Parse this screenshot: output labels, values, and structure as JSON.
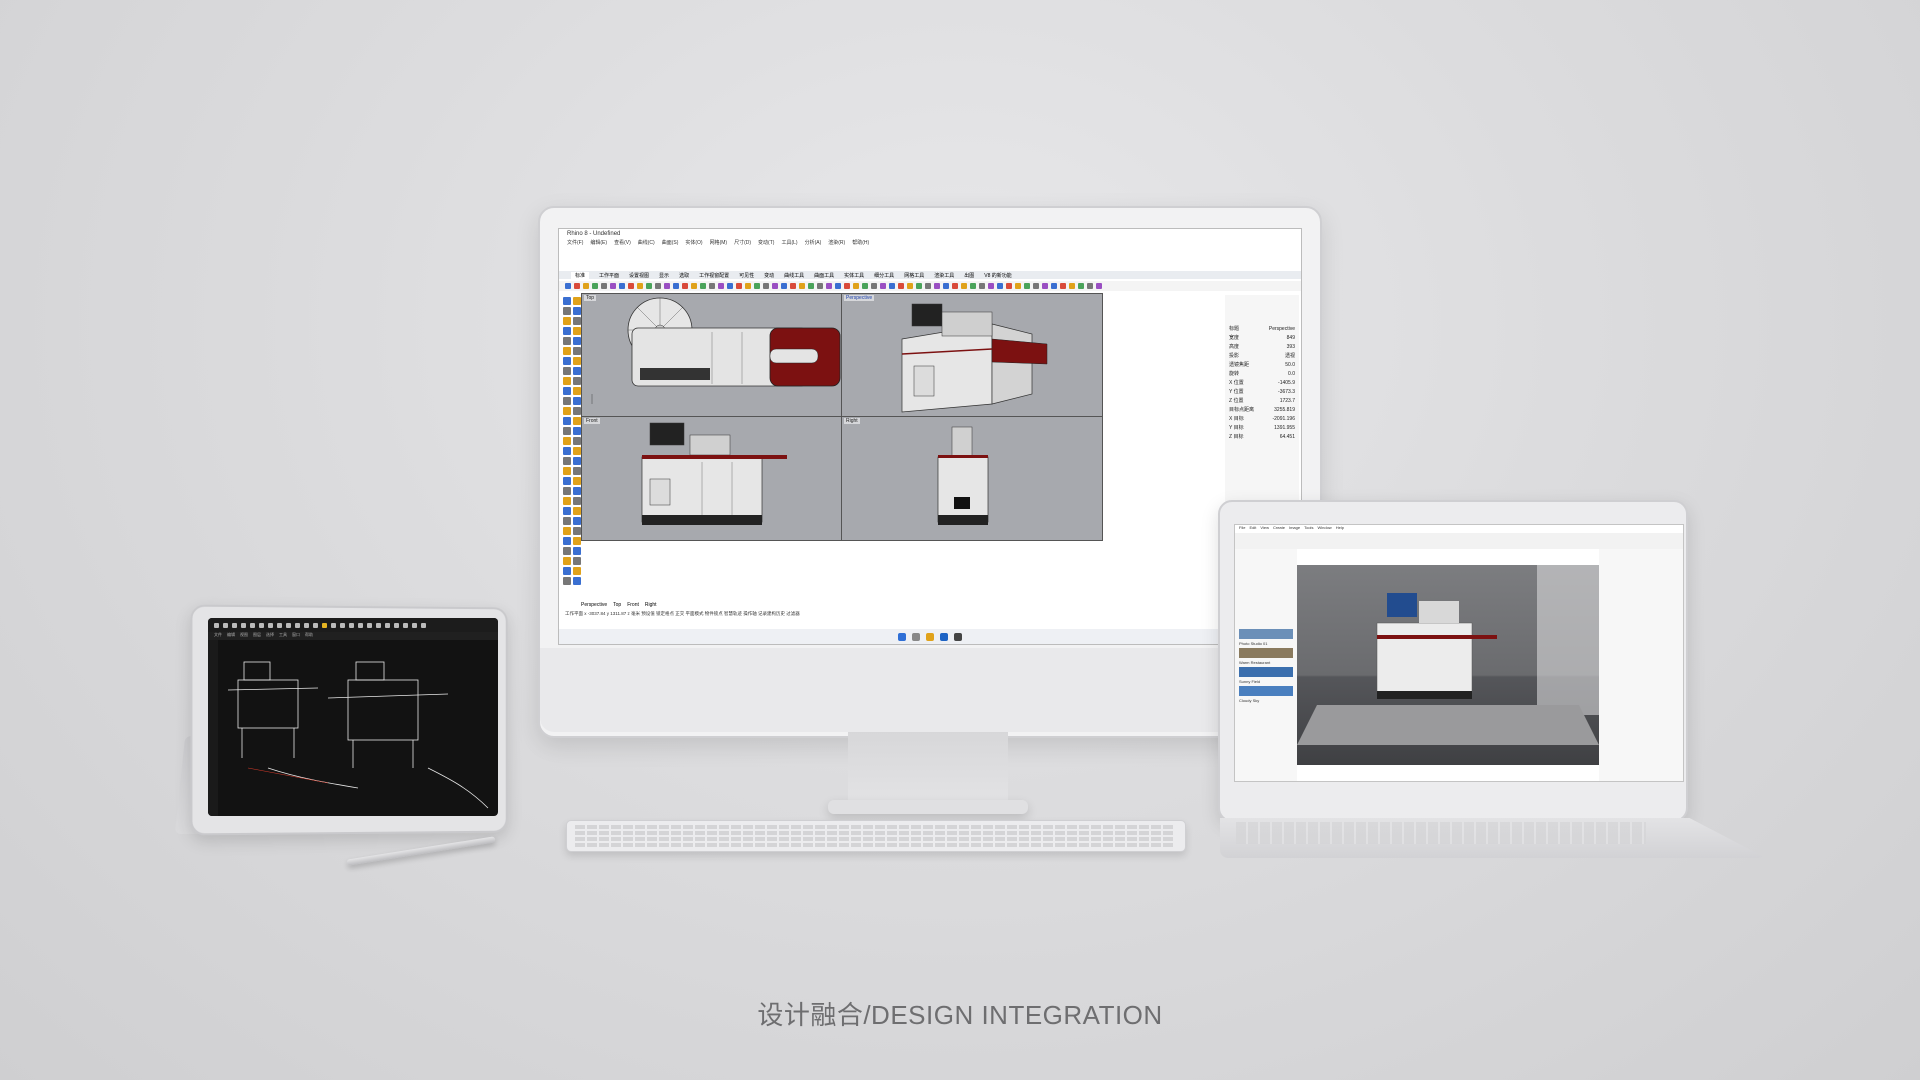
{
  "caption": "设计融合/DESIGN INTEGRATION",
  "monitor": {
    "window_title": "Rhino 8 - Undefined",
    "menus": [
      "文件(F)",
      "编辑(E)",
      "查看(V)",
      "曲线(C)",
      "曲面(S)",
      "实体(O)",
      "网格(M)",
      "尺寸(D)",
      "变动(T)",
      "工具(L)",
      "分析(A)",
      "渲染(R)",
      "帮助(H)"
    ],
    "tabs": [
      "标准",
      "工作平面",
      "设置视图",
      "显示",
      "选取",
      "工作视窗配置",
      "可见性",
      "变动",
      "曲线工具",
      "曲面工具",
      "实体工具",
      "细分工具",
      "网格工具",
      "渲染工具",
      "出图",
      "V8 的新功能"
    ],
    "viewports": [
      "Top",
      "Perspective",
      "Front",
      "Right"
    ],
    "viewport_tabs": [
      "Perspective",
      "Top",
      "Front",
      "Right"
    ],
    "properties": [
      {
        "k": "标题",
        "v": "Perspective"
      },
      {
        "k": "宽度",
        "v": "849"
      },
      {
        "k": "高度",
        "v": "393"
      },
      {
        "k": "投影",
        "v": "透视"
      },
      {
        "k": "透镜焦距",
        "v": "50.0"
      },
      {
        "k": "旋转",
        "v": "0.0"
      },
      {
        "k": "X 位置",
        "v": "-1405.9"
      },
      {
        "k": "Y 位置",
        "v": "-3673.3"
      },
      {
        "k": "Z 位置",
        "v": "1723.7"
      },
      {
        "k": "目标点距离",
        "v": "3255.819"
      },
      {
        "k": "X 目标",
        "v": "-2091.196"
      },
      {
        "k": "Y 目标",
        "v": "1391.955"
      },
      {
        "k": "Z 目标",
        "v": "64.451"
      }
    ],
    "status": "工作平面   x -3037.84   y 1311.87   z   毫米   预设值   锁定格点  正交  平面模式  物件锁点  智慧轨迹  操作轴  记录建构历史  过滤器"
  },
  "tablet": {
    "menus": [
      "文件",
      "编辑",
      "视图",
      "图层",
      "选择",
      "工具",
      "窗口",
      "帮助"
    ]
  },
  "laptop": {
    "menus": [
      "File",
      "Edit",
      "View",
      "Create",
      "Image",
      "Tools",
      "Window",
      "Help"
    ],
    "hdri_list": [
      "Photo Studio 01",
      "Warm Restaurant",
      "Sunny Field",
      "Cloudy Sky"
    ]
  },
  "colors": {
    "accent_red": "#7c1111",
    "machine_white": "#e6e6e6",
    "viewport_gray": "#a7a9ae"
  }
}
